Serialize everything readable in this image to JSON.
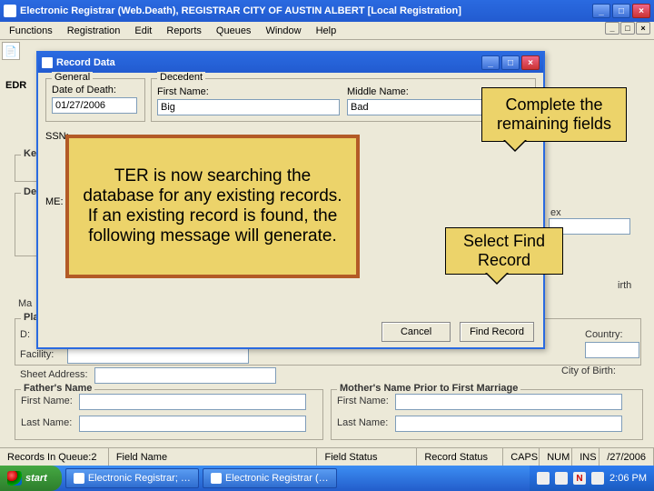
{
  "app": {
    "title": "Electronic Registrar (Web.Death), REGISTRAR   CITY OF AUSTIN   ALBERT   [Local Registration]"
  },
  "menu": {
    "functions": "Functions",
    "registration": "Registration",
    "edit": "Edit",
    "reports": "Reports",
    "queues": "Queues",
    "window": "Window",
    "help": "Help"
  },
  "edr_label": "EDR ",
  "record_window": {
    "title": "Record Data",
    "general_legend": "General",
    "decedent_legend": "Decedent",
    "date_of_death_label": "Date of Death:",
    "date_of_death_value": "01/27/2006",
    "first_name_label": "First Name:",
    "first_name_value": "Big",
    "middle_name_label": "Middle Name:",
    "middle_name_value": "Bad",
    "ssn_label": "SSN:",
    "me_label": "ME:",
    "cancel": "Cancel",
    "find_record": "Find Record"
  },
  "bg": {
    "key": "Key",
    "dec": "Dec",
    "ma": "Ma",
    "pla": "Pla",
    "d_label": "D:",
    "facility": "Facility:",
    "sheet_address": "Sheet Address:",
    "fathers_name": "Father's Name",
    "mothers_name": "Mother's Name Prior to First Marriage",
    "first_name": "First Name:",
    "last_name": "Last Name:",
    "sex": "ex",
    "birth_suffix": "irth",
    "country": "Country:",
    "city_of_birth": "City of Birth:"
  },
  "callouts": {
    "complete": "Complete the remaining fields",
    "select_find": "Select Find Record",
    "searching": "TER is now searching the database for any existing records. If an existing record is found, the following message will generate."
  },
  "status": {
    "records_in_queue": "Records In Queue:2",
    "field_name": "Field Name",
    "field_status": "Field Status",
    "record_status": "Record Status",
    "caps": "CAPS",
    "num": "NUM",
    "ins": "INS",
    "date_partial": "/27/2006"
  },
  "taskbar": {
    "start": "start",
    "task1": "Electronic Registrar; …",
    "task2": "Electronic Registrar (…",
    "tray_n": "N",
    "time": "2:06 PM"
  }
}
